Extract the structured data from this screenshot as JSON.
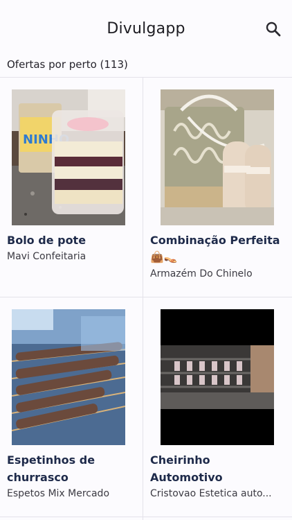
{
  "app": {
    "title": "Divulgapp"
  },
  "header": {
    "search_icon": "search-icon"
  },
  "section": {
    "title": "Ofertas por perto (113)"
  },
  "offers": [
    {
      "name": "Bolo de pote",
      "emoji": "",
      "store": "Mavi Confeitaria"
    },
    {
      "name": "Combinação Perfeita",
      "emoji": "👜👡",
      "store": "Armazém Do Chinelo"
    },
    {
      "name": "Espetinhos de churrasco",
      "emoji": "",
      "store": "Espetos Mix Mercado"
    },
    {
      "name": "Cheirinho Automotivo",
      "emoji": "",
      "store": "Cristovao Estetica auto..."
    }
  ],
  "colors": {
    "title_text": "#1e2a4a",
    "divider": "#e4e2ea",
    "background": "#fcfbfe"
  }
}
